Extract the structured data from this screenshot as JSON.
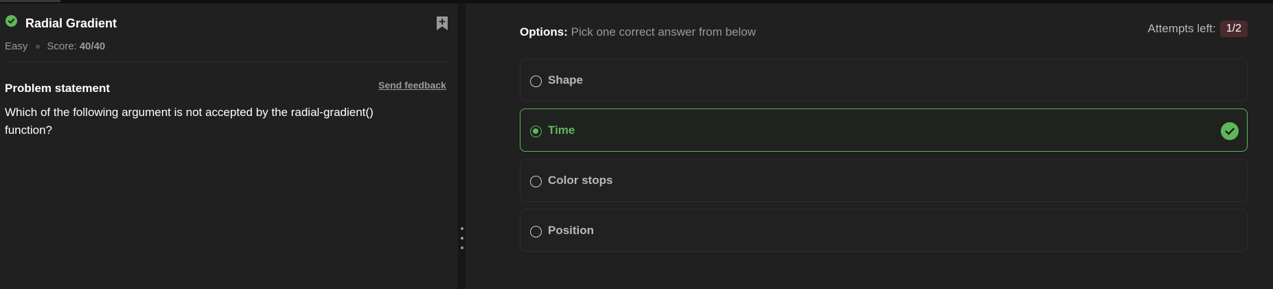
{
  "problem": {
    "title": "Radial Gradient",
    "difficulty": "Easy",
    "score_label": "Score:",
    "score_value": "40/40",
    "statement_heading": "Problem statement",
    "feedback_link": "Send feedback",
    "question": "Which of the following argument is not accepted by the radial-gradient() function?"
  },
  "options_panel": {
    "heading_bold": "Options:",
    "heading_rest": " Pick one correct answer from below",
    "attempts_label": "Attempts left:",
    "attempts_value": "1/2",
    "options": [
      {
        "label": "Shape",
        "selected": false,
        "correct": false
      },
      {
        "label": "Time",
        "selected": true,
        "correct": true
      },
      {
        "label": "Color stops",
        "selected": false,
        "correct": false
      },
      {
        "label": "Position",
        "selected": false,
        "correct": false
      }
    ]
  },
  "colors": {
    "accent_green": "#5fb75b",
    "badge_bg": "#4a2a2d",
    "panel_bg": "#202020"
  },
  "icons": {
    "status": "check-circle-icon",
    "bookmark": "bookmark-add-icon",
    "correct": "check-circle-icon",
    "splitter": "drag-handle-icon"
  }
}
